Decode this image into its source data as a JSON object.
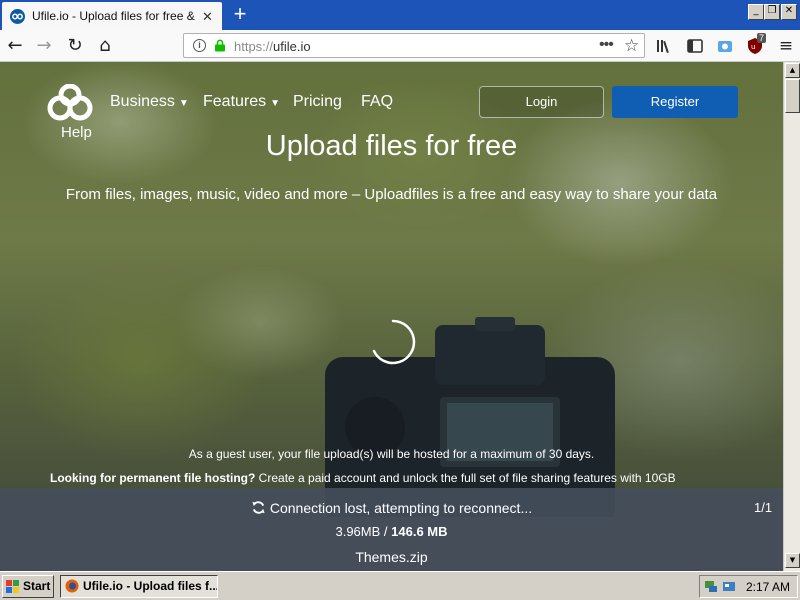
{
  "browser": {
    "tab_title": "Ufile.io - Upload files for free & sh",
    "tab_close": "✕",
    "new_tab": "+",
    "url_scheme": "https://",
    "url_host": "ufile.io",
    "page_actions": "•••",
    "bookmark_star": "☆",
    "addon_badge": "7",
    "window_controls": {
      "minimize": "_",
      "restore": "❐",
      "close": "✕"
    },
    "nav": {
      "back": "←",
      "forward": "→",
      "reload": "↻",
      "home": "⌂"
    },
    "menu": "≡"
  },
  "site": {
    "logo_label": "Help",
    "nav": [
      {
        "label": "Business",
        "dropdown": true
      },
      {
        "label": "Features",
        "dropdown": true
      },
      {
        "label": "Pricing",
        "dropdown": false
      },
      {
        "label": "FAQ",
        "dropdown": false
      }
    ],
    "login_label": "Login",
    "register_label": "Register",
    "hero_title": "Upload files for free",
    "hero_subtitle": "From files, images, music, video and more – Uploadfiles is a free and easy way to share your data",
    "guest_note": "As a guest user, your file upload(s) will be hosted for a maximum of 30 days.",
    "permanent_bold": "Looking for permanent file hosting?",
    "permanent_rest": " Create a paid account and unlock the full set of file sharing features with 10GB",
    "accent_color": "#0f5eb3"
  },
  "upload": {
    "status": "Connection lost, attempting to reconnect...",
    "count": "1/1",
    "uploaded": "3.96MB",
    "separator": " / ",
    "total": "146.6 MB",
    "filename": "Themes.zip"
  },
  "taskbar": {
    "start_label": "Start",
    "window_label": "Ufile.io - Upload files f...",
    "clock": "2:17 AM"
  },
  "scrollbar": {
    "up": "▲",
    "down": "▼"
  }
}
